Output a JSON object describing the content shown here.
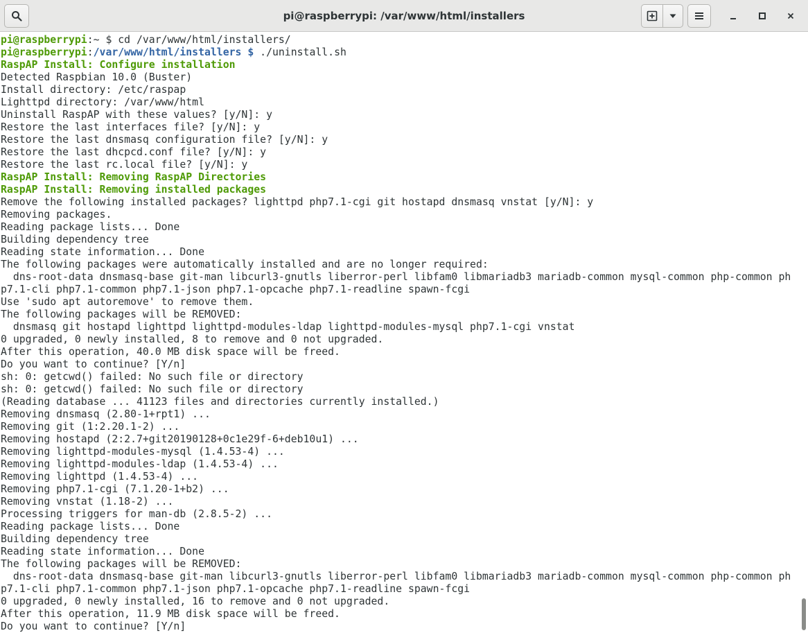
{
  "window": {
    "title": "pi@raspberrypi: /var/www/html/installers"
  },
  "toolbar": {
    "search_icon": "search-icon",
    "new_tab_icon": "new-tab-icon",
    "tab_menu_icon": "chevron-down-icon",
    "menu_icon": "hamburger-menu-icon",
    "minimize_icon": "minimize-icon",
    "maximize_icon": "maximize-icon",
    "close_icon": "close-icon"
  },
  "colors": {
    "prompt_green": "#4e9a06",
    "path_blue": "#3465a4",
    "text": "#2e3436"
  },
  "terminal": {
    "lines": [
      [
        {
          "t": "pi@raspberrypi",
          "c": "bold-green"
        },
        {
          "t": ":~ $ ",
          "c": "plain"
        },
        {
          "t": "cd /var/www/html/installers/",
          "c": "plain"
        }
      ],
      [
        {
          "t": "pi@raspberrypi",
          "c": "bold-green"
        },
        {
          "t": ":",
          "c": "plain"
        },
        {
          "t": "/var/www/html/installers $",
          "c": "bold-blue"
        },
        {
          "t": " ./uninstall.sh",
          "c": "plain"
        }
      ],
      [
        {
          "t": "RaspAP Install: Configure installation",
          "c": "bold-green"
        }
      ],
      [
        {
          "t": "Detected Raspbian 10.0 (Buster)",
          "c": "plain"
        }
      ],
      [
        {
          "t": "Install directory: /etc/raspap",
          "c": "plain"
        }
      ],
      [
        {
          "t": "Lighttpd directory: /var/www/html",
          "c": "plain"
        }
      ],
      [
        {
          "t": "Uninstall RaspAP with these values? [y/N]: y",
          "c": "plain"
        }
      ],
      [
        {
          "t": "Restore the last interfaces file? [y/N]: y",
          "c": "plain"
        }
      ],
      [
        {
          "t": "Restore the last dnsmasq configuration file? [y/N]: y",
          "c": "plain"
        }
      ],
      [
        {
          "t": "Restore the last dhcpcd.conf file? [y/N]: y",
          "c": "plain"
        }
      ],
      [
        {
          "t": "Restore the last rc.local file? [y/N]: y",
          "c": "plain"
        }
      ],
      [
        {
          "t": "RaspAP Install: Removing RaspAP Directories",
          "c": "bold-green"
        }
      ],
      [
        {
          "t": "RaspAP Install: Removing installed packages",
          "c": "bold-green"
        }
      ],
      [
        {
          "t": "Remove the following installed packages? lighttpd php7.1-cgi git hostapd dnsmasq vnstat [y/N]: y",
          "c": "plain"
        }
      ],
      [
        {
          "t": "Removing packages.",
          "c": "plain"
        }
      ],
      [
        {
          "t": "Reading package lists... Done",
          "c": "plain"
        }
      ],
      [
        {
          "t": "Building dependency tree",
          "c": "plain"
        }
      ],
      [
        {
          "t": "Reading state information... Done",
          "c": "plain"
        }
      ],
      [
        {
          "t": "The following packages were automatically installed and are no longer required:",
          "c": "plain"
        }
      ],
      [
        {
          "t": "  dns-root-data dnsmasq-base git-man libcurl3-gnutls liberror-perl libfam0 libmariadb3 mariadb-common mysql-common php-common ph",
          "c": "plain"
        }
      ],
      [
        {
          "t": "p7.1-cli php7.1-common php7.1-json php7.1-opcache php7.1-readline spawn-fcgi",
          "c": "plain"
        }
      ],
      [
        {
          "t": "Use 'sudo apt autoremove' to remove them.",
          "c": "plain"
        }
      ],
      [
        {
          "t": "The following packages will be REMOVED:",
          "c": "plain"
        }
      ],
      [
        {
          "t": "  dnsmasq git hostapd lighttpd lighttpd-modules-ldap lighttpd-modules-mysql php7.1-cgi vnstat",
          "c": "plain"
        }
      ],
      [
        {
          "t": "0 upgraded, 0 newly installed, 8 to remove and 0 not upgraded.",
          "c": "plain"
        }
      ],
      [
        {
          "t": "After this operation, 40.0 MB disk space will be freed.",
          "c": "plain"
        }
      ],
      [
        {
          "t": "Do you want to continue? [Y/n]",
          "c": "plain"
        }
      ],
      [
        {
          "t": "sh: 0: getcwd() failed: No such file or directory",
          "c": "plain"
        }
      ],
      [
        {
          "t": "sh: 0: getcwd() failed: No such file or directory",
          "c": "plain"
        }
      ],
      [
        {
          "t": "(Reading database ... 41123 files and directories currently installed.)",
          "c": "plain"
        }
      ],
      [
        {
          "t": "Removing dnsmasq (2.80-1+rpt1) ...",
          "c": "plain"
        }
      ],
      [
        {
          "t": "Removing git (1:2.20.1-2) ...",
          "c": "plain"
        }
      ],
      [
        {
          "t": "Removing hostapd (2:2.7+git20190128+0c1e29f-6+deb10u1) ...",
          "c": "plain"
        }
      ],
      [
        {
          "t": "Removing lighttpd-modules-mysql (1.4.53-4) ...",
          "c": "plain"
        }
      ],
      [
        {
          "t": "Removing lighttpd-modules-ldap (1.4.53-4) ...",
          "c": "plain"
        }
      ],
      [
        {
          "t": "Removing lighttpd (1.4.53-4) ...",
          "c": "plain"
        }
      ],
      [
        {
          "t": "Removing php7.1-cgi (7.1.20-1+b2) ...",
          "c": "plain"
        }
      ],
      [
        {
          "t": "Removing vnstat (1.18-2) ...",
          "c": "plain"
        }
      ],
      [
        {
          "t": "Processing triggers for man-db (2.8.5-2) ...",
          "c": "plain"
        }
      ],
      [
        {
          "t": "Reading package lists... Done",
          "c": "plain"
        }
      ],
      [
        {
          "t": "Building dependency tree",
          "c": "plain"
        }
      ],
      [
        {
          "t": "Reading state information... Done",
          "c": "plain"
        }
      ],
      [
        {
          "t": "The following packages will be REMOVED:",
          "c": "plain"
        }
      ],
      [
        {
          "t": "  dns-root-data dnsmasq-base git-man libcurl3-gnutls liberror-perl libfam0 libmariadb3 mariadb-common mysql-common php-common ph",
          "c": "plain"
        }
      ],
      [
        {
          "t": "p7.1-cli php7.1-common php7.1-json php7.1-opcache php7.1-readline spawn-fcgi",
          "c": "plain"
        }
      ],
      [
        {
          "t": "0 upgraded, 0 newly installed, 16 to remove and 0 not upgraded.",
          "c": "plain"
        }
      ],
      [
        {
          "t": "After this operation, 11.9 MB disk space will be freed.",
          "c": "plain"
        }
      ],
      [
        {
          "t": "Do you want to continue? [Y/n]",
          "c": "plain"
        }
      ]
    ]
  }
}
